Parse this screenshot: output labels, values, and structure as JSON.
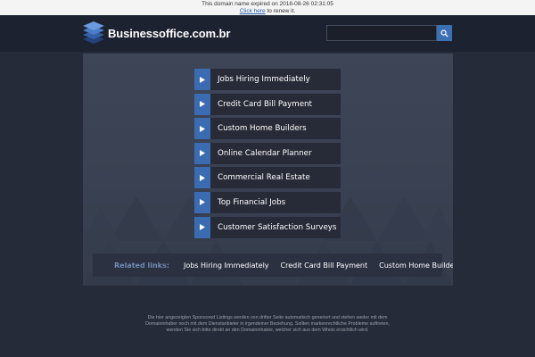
{
  "banner": {
    "line1": "This domain name expired on 2018-08-26 02:31:05",
    "link_text": "Click here",
    "line2_suffix": " to renew it."
  },
  "header": {
    "site_name": "Businessoffice.com.br",
    "search_placeholder": "",
    "search_icon": "search-icon"
  },
  "links": [
    {
      "label": "Jobs Hiring Immediately"
    },
    {
      "label": "Credit Card Bill Payment"
    },
    {
      "label": "Custom Home Builders"
    },
    {
      "label": "Online Calendar Planner"
    },
    {
      "label": "Commercial Real Estate"
    },
    {
      "label": "Top Financial Jobs"
    },
    {
      "label": "Customer Satisfaction Surveys"
    }
  ],
  "related": {
    "label": "Related links:",
    "items": [
      {
        "label": "Jobs Hiring Immediately"
      },
      {
        "label": "Credit Card Bill Payment"
      },
      {
        "label": "Custom Home Builders"
      }
    ]
  },
  "footer": {
    "line1": "Die hier angezeigten Sponsored Listings werden von dritter Seite automatisch generiert und stehen weder mit dem",
    "line2": "Domaininhaber noch mit dem Dienstanbieter in irgendeiner Beziehung. Sollten markenrechtliche Probleme auftreten,",
    "line3": "wenden Sie sich bitte direkt an den Domaininhaber, welcher sich aus dem Whois ersichtlich wird."
  },
  "colors": {
    "page_bg": "#252b38",
    "accent": "#3b6bb1",
    "panel_bg": "#3d4557",
    "item_bg": "#262b37"
  }
}
